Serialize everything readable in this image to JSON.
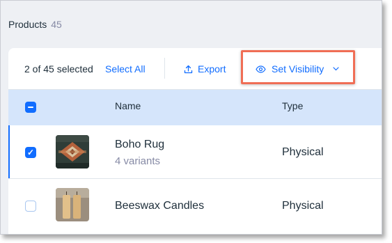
{
  "header": {
    "title": "Products",
    "count": "45"
  },
  "toolbar": {
    "selection_text": "2 of 45 selected",
    "select_all_label": "Select All",
    "export_label": "Export",
    "set_visibility_label": "Set Visibility"
  },
  "table": {
    "columns": {
      "name": "Name",
      "type": "Type"
    },
    "rows": [
      {
        "name": "Boho Rug",
        "variants": "4 variants",
        "type": "Physical",
        "selected": true
      },
      {
        "name": "Beeswax Candles",
        "variants": "",
        "type": "Physical",
        "selected": false
      }
    ]
  },
  "colors": {
    "accent": "#116dff",
    "highlight": "#f06e55",
    "header_row": "#d5e5fb"
  },
  "icons": [
    "upload-icon",
    "eye-icon",
    "chevron-down-icon",
    "checkmark-icon",
    "minus-icon"
  ]
}
